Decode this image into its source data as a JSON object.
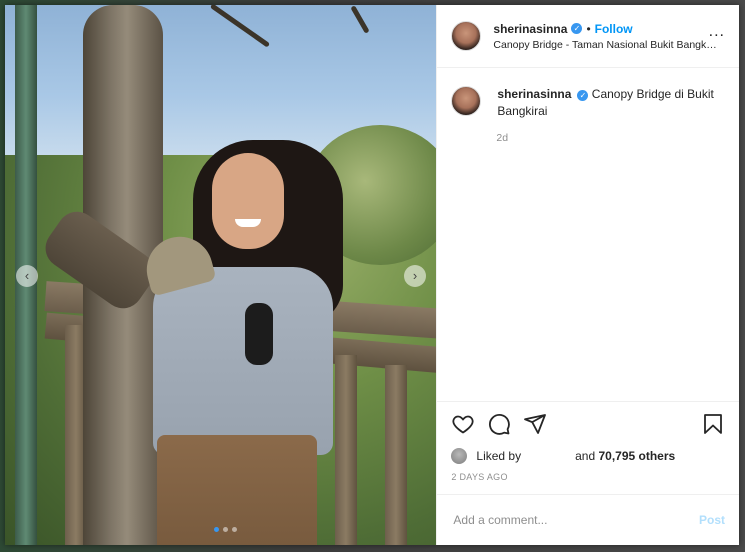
{
  "post": {
    "username": "sherinasinna",
    "verified": true,
    "separator": "•",
    "follow_label": "Follow",
    "location": "Canopy Bridge - Taman Nasional Bukit Bangkirai",
    "more_label": "...",
    "caption": "Canopy Bridge di Bukit Bangkirai",
    "caption_age": "2d",
    "liked_by_label": "Liked by",
    "liked_by_and": "and",
    "likes_count": "70,795 others",
    "date_label": "2 DAYS AGO",
    "comment_placeholder": "Add a comment...",
    "post_label": "Post"
  },
  "carousel": {
    "prev_icon": "‹",
    "next_icon": "›",
    "slide_count": 3,
    "active_slide": 1
  },
  "colors": {
    "accent": "#0095f6",
    "verified": "#3897f0",
    "post_disabled": "#b2dffc",
    "muted": "#8e8e8e"
  },
  "icons": [
    "heart-icon",
    "comment-icon",
    "share-icon",
    "bookmark-icon",
    "verified-icon",
    "more-icon"
  ]
}
